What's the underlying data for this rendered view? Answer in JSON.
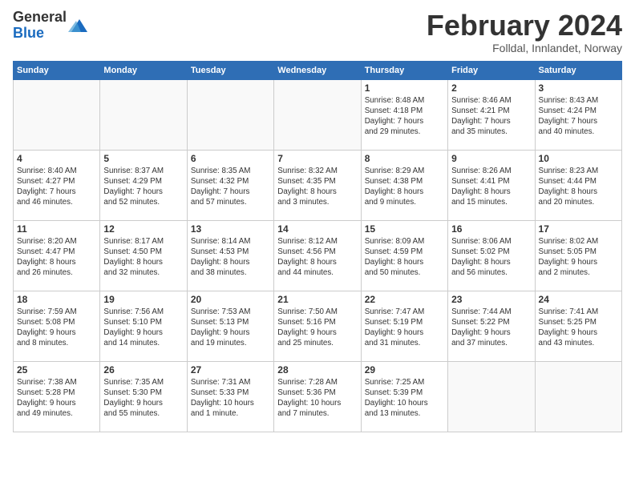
{
  "logo": {
    "general": "General",
    "blue": "Blue"
  },
  "header": {
    "month": "February 2024",
    "location": "Folldal, Innlandet, Norway"
  },
  "weekdays": [
    "Sunday",
    "Monday",
    "Tuesday",
    "Wednesday",
    "Thursday",
    "Friday",
    "Saturday"
  ],
  "weeks": [
    [
      {
        "day": "",
        "info": ""
      },
      {
        "day": "",
        "info": ""
      },
      {
        "day": "",
        "info": ""
      },
      {
        "day": "",
        "info": ""
      },
      {
        "day": "1",
        "info": "Sunrise: 8:48 AM\nSunset: 4:18 PM\nDaylight: 7 hours\nand 29 minutes."
      },
      {
        "day": "2",
        "info": "Sunrise: 8:46 AM\nSunset: 4:21 PM\nDaylight: 7 hours\nand 35 minutes."
      },
      {
        "day": "3",
        "info": "Sunrise: 8:43 AM\nSunset: 4:24 PM\nDaylight: 7 hours\nand 40 minutes."
      }
    ],
    [
      {
        "day": "4",
        "info": "Sunrise: 8:40 AM\nSunset: 4:27 PM\nDaylight: 7 hours\nand 46 minutes."
      },
      {
        "day": "5",
        "info": "Sunrise: 8:37 AM\nSunset: 4:29 PM\nDaylight: 7 hours\nand 52 minutes."
      },
      {
        "day": "6",
        "info": "Sunrise: 8:35 AM\nSunset: 4:32 PM\nDaylight: 7 hours\nand 57 minutes."
      },
      {
        "day": "7",
        "info": "Sunrise: 8:32 AM\nSunset: 4:35 PM\nDaylight: 8 hours\nand 3 minutes."
      },
      {
        "day": "8",
        "info": "Sunrise: 8:29 AM\nSunset: 4:38 PM\nDaylight: 8 hours\nand 9 minutes."
      },
      {
        "day": "9",
        "info": "Sunrise: 8:26 AM\nSunset: 4:41 PM\nDaylight: 8 hours\nand 15 minutes."
      },
      {
        "day": "10",
        "info": "Sunrise: 8:23 AM\nSunset: 4:44 PM\nDaylight: 8 hours\nand 20 minutes."
      }
    ],
    [
      {
        "day": "11",
        "info": "Sunrise: 8:20 AM\nSunset: 4:47 PM\nDaylight: 8 hours\nand 26 minutes."
      },
      {
        "day": "12",
        "info": "Sunrise: 8:17 AM\nSunset: 4:50 PM\nDaylight: 8 hours\nand 32 minutes."
      },
      {
        "day": "13",
        "info": "Sunrise: 8:14 AM\nSunset: 4:53 PM\nDaylight: 8 hours\nand 38 minutes."
      },
      {
        "day": "14",
        "info": "Sunrise: 8:12 AM\nSunset: 4:56 PM\nDaylight: 8 hours\nand 44 minutes."
      },
      {
        "day": "15",
        "info": "Sunrise: 8:09 AM\nSunset: 4:59 PM\nDaylight: 8 hours\nand 50 minutes."
      },
      {
        "day": "16",
        "info": "Sunrise: 8:06 AM\nSunset: 5:02 PM\nDaylight: 8 hours\nand 56 minutes."
      },
      {
        "day": "17",
        "info": "Sunrise: 8:02 AM\nSunset: 5:05 PM\nDaylight: 9 hours\nand 2 minutes."
      }
    ],
    [
      {
        "day": "18",
        "info": "Sunrise: 7:59 AM\nSunset: 5:08 PM\nDaylight: 9 hours\nand 8 minutes."
      },
      {
        "day": "19",
        "info": "Sunrise: 7:56 AM\nSunset: 5:10 PM\nDaylight: 9 hours\nand 14 minutes."
      },
      {
        "day": "20",
        "info": "Sunrise: 7:53 AM\nSunset: 5:13 PM\nDaylight: 9 hours\nand 19 minutes."
      },
      {
        "day": "21",
        "info": "Sunrise: 7:50 AM\nSunset: 5:16 PM\nDaylight: 9 hours\nand 25 minutes."
      },
      {
        "day": "22",
        "info": "Sunrise: 7:47 AM\nSunset: 5:19 PM\nDaylight: 9 hours\nand 31 minutes."
      },
      {
        "day": "23",
        "info": "Sunrise: 7:44 AM\nSunset: 5:22 PM\nDaylight: 9 hours\nand 37 minutes."
      },
      {
        "day": "24",
        "info": "Sunrise: 7:41 AM\nSunset: 5:25 PM\nDaylight: 9 hours\nand 43 minutes."
      }
    ],
    [
      {
        "day": "25",
        "info": "Sunrise: 7:38 AM\nSunset: 5:28 PM\nDaylight: 9 hours\nand 49 minutes."
      },
      {
        "day": "26",
        "info": "Sunrise: 7:35 AM\nSunset: 5:30 PM\nDaylight: 9 hours\nand 55 minutes."
      },
      {
        "day": "27",
        "info": "Sunrise: 7:31 AM\nSunset: 5:33 PM\nDaylight: 10 hours\nand 1 minute."
      },
      {
        "day": "28",
        "info": "Sunrise: 7:28 AM\nSunset: 5:36 PM\nDaylight: 10 hours\nand 7 minutes."
      },
      {
        "day": "29",
        "info": "Sunrise: 7:25 AM\nSunset: 5:39 PM\nDaylight: 10 hours\nand 13 minutes."
      },
      {
        "day": "",
        "info": ""
      },
      {
        "day": "",
        "info": ""
      }
    ]
  ]
}
